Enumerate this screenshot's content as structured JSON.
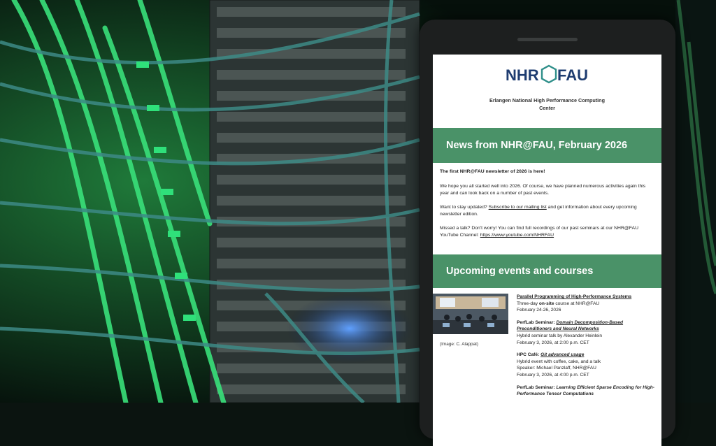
{
  "logo": {
    "left": "NHR",
    "right": "FAU",
    "mark_color": "#2f8f8a",
    "text_color": "#1e3c70"
  },
  "organization": "Erlangen National High Performance Computing Center",
  "news_heading": "News from NHR@FAU, February 2026",
  "intro": {
    "lead": "The first NHR@FAU newsletter of 2026 is here!",
    "p1": "We hope you all started well into 2026. Of course, we have planned numerous activities again this year and can look back on a number of past events.",
    "p2_before": "Want to stay updated? ",
    "p2_link": "Subscribe to our mailing list",
    "p2_after": " and get information about every upcoming newsletter edition.",
    "p3_before": "Missed a talk? Don't worry! You can find full recordings of our past seminars at our NHR@FAU YouTube Channel: ",
    "p3_link": "https://www.youtube.com/NHRFAU"
  },
  "events_heading": "Upcoming events and courses",
  "photo_caption": "(Image: C. Alappat)",
  "events": [
    {
      "title_prefix": "",
      "title": "Parallel Programming of High-Performance Systems",
      "line1_a": "Three-day ",
      "line1_b": "on-site",
      "line1_c": " course at NHR@FAU",
      "line2": "February 24-26, 2026",
      "line3": ""
    },
    {
      "title_prefix": "PerfLab Seminar: ",
      "title": "Domain Decomposition-Based Preconditioners and Neural Networks",
      "line1_a": "Hybrid seminar talk by Alexander Heinlein",
      "line1_b": "",
      "line1_c": "",
      "line2": "February 3, 2026, at 2:00 p.m. CET",
      "line3": ""
    },
    {
      "title_prefix": "HPC Café: ",
      "title": "Git advanced usage",
      "line1_a": "Hybrid event with coffee, cake, and a talk",
      "line1_b": "",
      "line1_c": "",
      "line2": "Speaker: Michael Panzlaff, NHR@FAU",
      "line3": "February 3, 2026, at 4:00 p.m. CET"
    },
    {
      "title_prefix": "PerfLab Seminar: ",
      "title": "Learning Efficient Sparse Encoding for High-Performance Tensor Computations",
      "line1_a": "",
      "line1_b": "",
      "line1_c": "",
      "line2": "",
      "line3": ""
    }
  ],
  "colors": {
    "banner": "#4a9268",
    "phone": "#1d1f1f",
    "cable_green": "#39e07a"
  }
}
